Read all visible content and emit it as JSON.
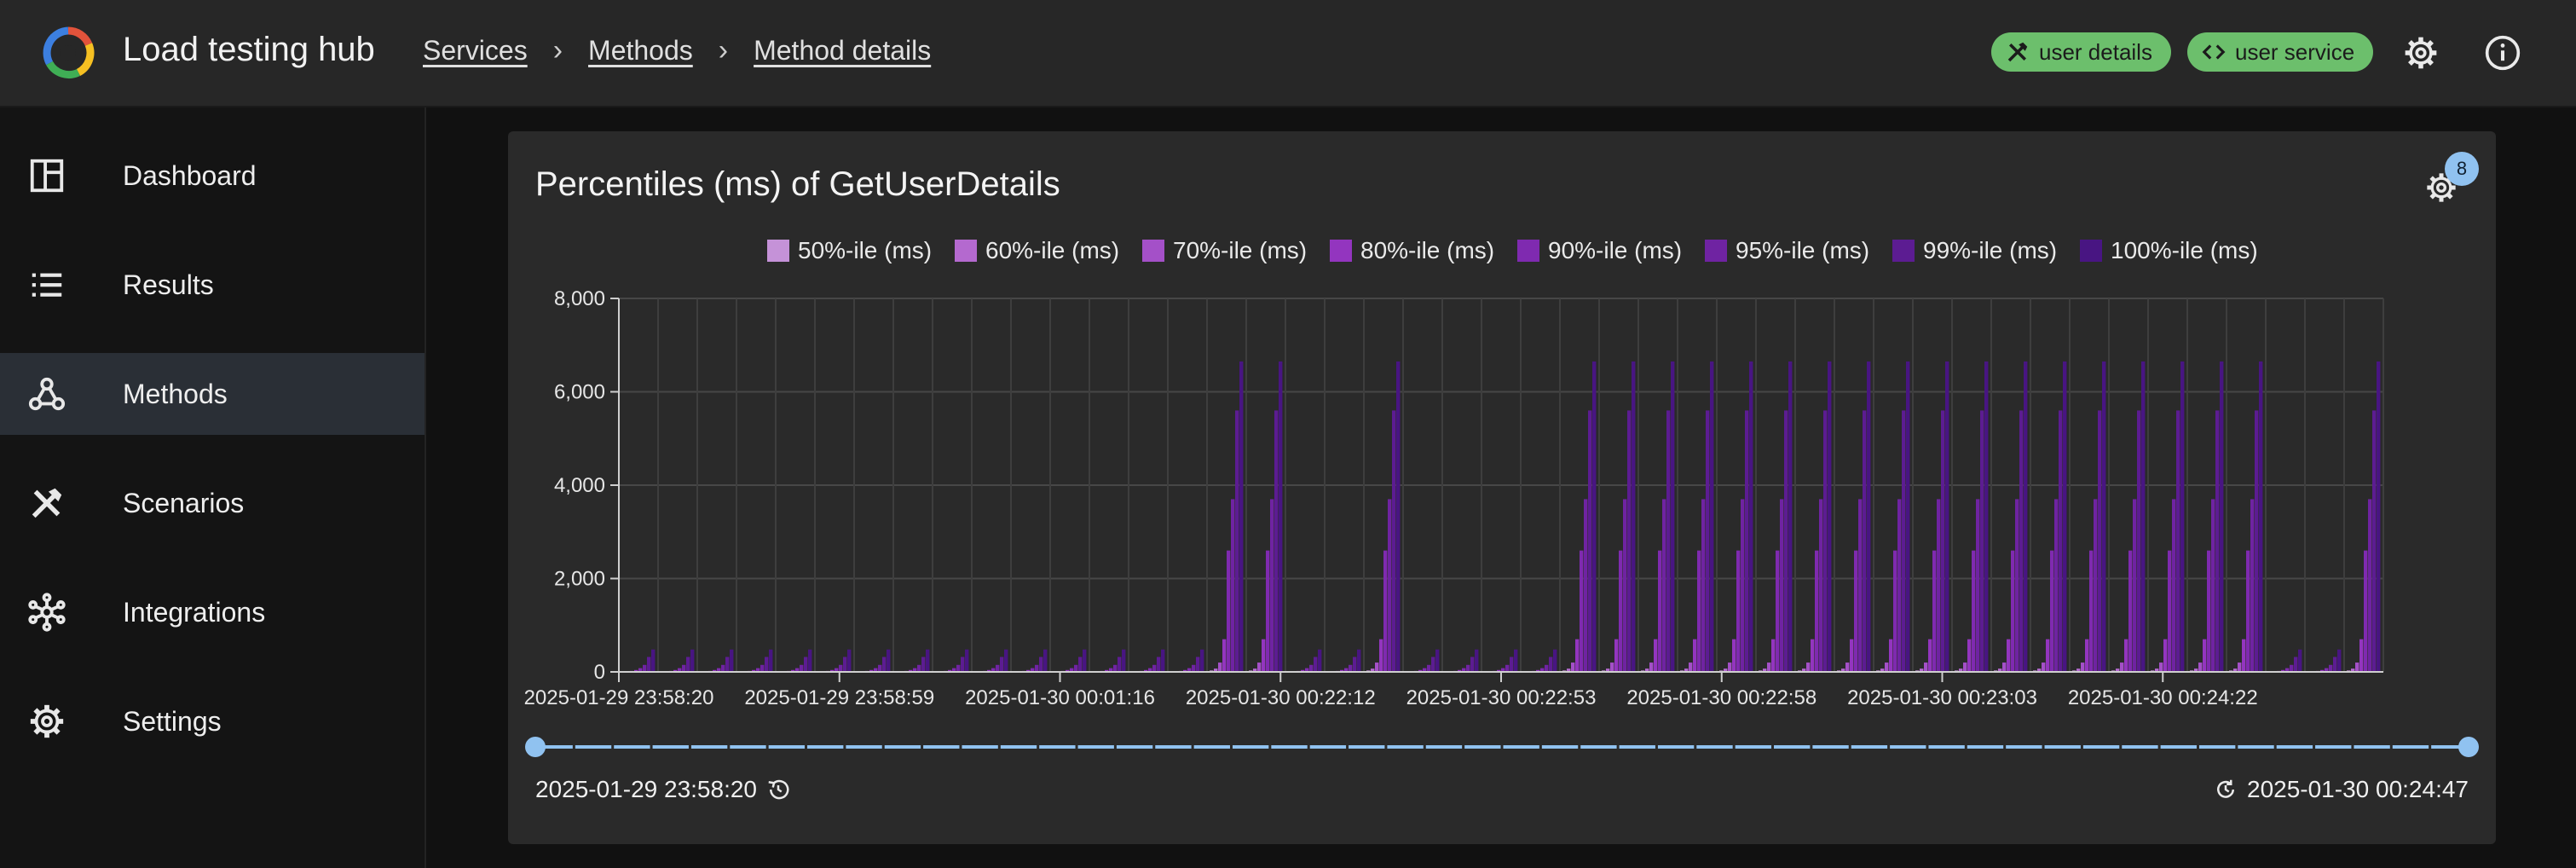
{
  "app": {
    "title": "Load testing hub"
  },
  "breadcrumbs": [
    "Services",
    "Methods",
    "Method details"
  ],
  "chips": [
    {
      "label": "user details",
      "icon": "hammer-wrench-icon"
    },
    {
      "label": "user service",
      "icon": "code-icon"
    }
  ],
  "sidebar": {
    "items": [
      {
        "label": "Dashboard",
        "icon": "dashboard-icon",
        "active": false
      },
      {
        "label": "Results",
        "icon": "list-icon",
        "active": false
      },
      {
        "label": "Methods",
        "icon": "webhook-icon",
        "active": true
      },
      {
        "label": "Scenarios",
        "icon": "hammer-wrench-icon",
        "active": false
      },
      {
        "label": "Integrations",
        "icon": "hub-icon",
        "active": false
      },
      {
        "label": "Settings",
        "icon": "gear-icon",
        "active": false
      }
    ]
  },
  "card": {
    "title": "Percentiles (ms) of GetUserDetails",
    "settings_badge": "8",
    "range_start": "2025-01-29 23:58:20",
    "range_end": "2025-01-30 00:24:47"
  },
  "colors": {
    "accent": "#90c2f0",
    "chip_bg": "#6cbf6c",
    "series": [
      "#c592d8",
      "#b469cf",
      "#a450c8",
      "#9335bf",
      "#7f2ab0",
      "#6f23a2",
      "#5c1c92",
      "#481582"
    ]
  },
  "chart_data": {
    "type": "bar",
    "legend_position": "top-center",
    "grid": true,
    "ylim": [
      0,
      8000
    ],
    "yticks": [
      "0",
      "2,000",
      "4,000",
      "6,000",
      "8,000"
    ],
    "xtick_labels": [
      "2025-01-29 23:58:20",
      "2025-01-29 23:58:59",
      "2025-01-30 00:01:16",
      "2025-01-30 00:22:12",
      "2025-01-30 00:22:53",
      "2025-01-30 00:22:58",
      "2025-01-30 00:23:03",
      "2025-01-30 00:24:22"
    ],
    "series_names": [
      "50%-ile (ms)",
      "60%-ile (ms)",
      "70%-ile (ms)",
      "80%-ile (ms)",
      "90%-ile (ms)",
      "95%-ile (ms)",
      "99%-ile (ms)",
      "100%-ile (ms)"
    ],
    "group_count": 45,
    "group_profiles": {
      "low": [
        0,
        10,
        20,
        40,
        80,
        150,
        320,
        480
      ],
      "high": [
        15,
        30,
        70,
        200,
        700,
        2600,
        3700,
        5600,
        6650
      ]
    },
    "profile_by_group": "LLLLLLLLLLLLLLLHHLLHLLLLHHHHHHHHHHHHHHHHHHLLHL"
  }
}
